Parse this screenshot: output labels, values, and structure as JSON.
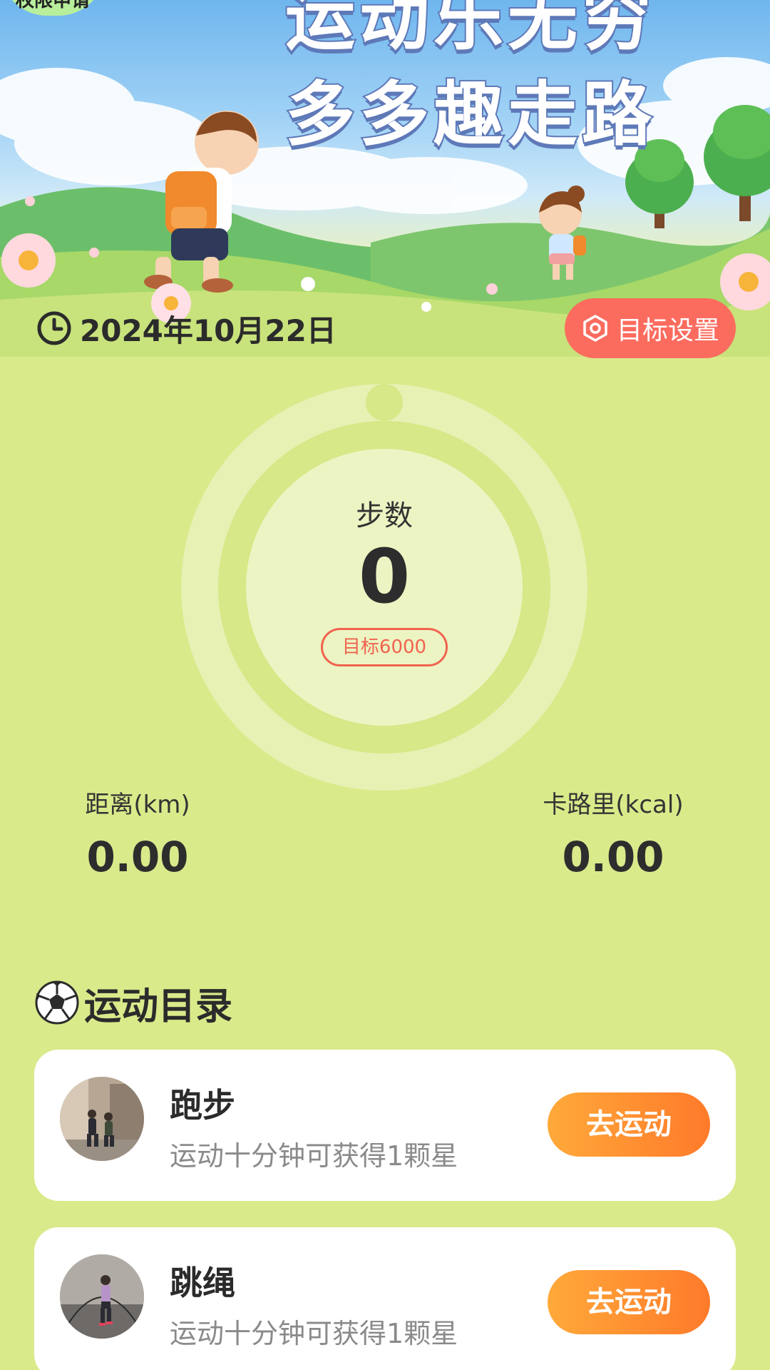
{
  "header": {
    "permission_badge": "权限申请",
    "title_line1": "运动乐无穷",
    "title_line2": "多多趣走路",
    "date": "2024年10月22日",
    "goal_button": "目标设置"
  },
  "steps": {
    "label": "步数",
    "value": "0",
    "goal": "目标6000",
    "progress": 0
  },
  "stats": {
    "distance_label": "距离(km)",
    "distance_value": "0.00",
    "calories_label": "卡路里(kcal)",
    "calories_value": "0.00"
  },
  "catalog": {
    "title": "运动目录",
    "items": [
      {
        "name": "跑步",
        "desc": "运动十分钟可获得1颗星",
        "button": "去运动"
      },
      {
        "name": "跳绳",
        "desc": "运动十分钟可获得1颗星",
        "button": "去运动"
      }
    ]
  },
  "colors": {
    "background": "#d9ea8b",
    "accent_red": "#fb6c5e",
    "button_orange": "#ff8a2f",
    "title_stroke": "#5e79b8"
  },
  "icons": [
    "clock-icon",
    "settings-hexagon-icon",
    "soccer-ball-icon"
  ]
}
